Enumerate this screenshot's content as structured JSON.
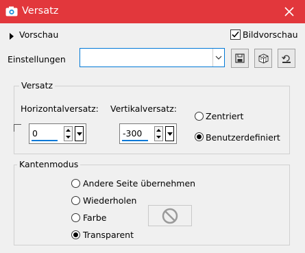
{
  "window": {
    "title": "Versatz",
    "icon": "camera-icon",
    "close_icon": "close-icon",
    "accent": "#e2373c"
  },
  "preview": {
    "toggle_label": "Vorschau",
    "checkbox_label": "Bildvorschau",
    "checked": true
  },
  "settings": {
    "label": "Einstellungen",
    "value": "",
    "icons": [
      "save-icon",
      "dice-icon",
      "reset-icon"
    ]
  },
  "offset": {
    "group_title": "Versatz",
    "horizontal_label": "Horizontalversatz:",
    "horizontal_value": "0",
    "vertical_label": "Vertikalversatz:",
    "vertical_value": "-300",
    "centered_label": "Zentriert",
    "custom_label": "Benutzerdefiniert",
    "selected": "custom",
    "link_checked": false
  },
  "edge": {
    "group_title": "Kantenmodus",
    "options": [
      "Andere Seite übernehmen",
      "Wiederholen",
      "Farbe",
      "Transparent"
    ],
    "selected": "Transparent",
    "color_button_icon": "no-sign-icon"
  }
}
